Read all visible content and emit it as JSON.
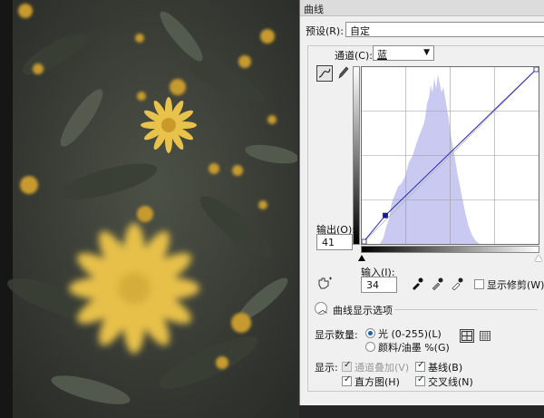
{
  "dialog": {
    "title": "曲线",
    "preset_label": "预设(R):",
    "preset_value": "自定",
    "channel_label": "通道(C):",
    "channel_value": "蓝",
    "output_label": "输出(O):",
    "output_value": "41",
    "input_label": "输入(I):",
    "input_value": "34",
    "show_clipping_label": "显示修剪(W)",
    "display_options_label": "曲线显示选项",
    "show_amount_label": "显示数量:",
    "light_label": "光 (0-255)(L)",
    "pigment_label": "颜料/油墨 %(G)",
    "show_label": "显示:",
    "channel_overlay_label": "通道叠加(V)",
    "baseline_label": "基线(B)",
    "histogram_label": "直方图(H)",
    "intersection_label": "交叉线(N)"
  },
  "state": {
    "light_selected": true,
    "channel_overlay_checked": true,
    "channel_overlay_disabled": true,
    "baseline_checked": true,
    "histogram_checked": true,
    "intersection_checked": true,
    "show_clipping_checked": false
  },
  "curve": {
    "points": [
      [
        0,
        0
      ],
      [
        34,
        41
      ],
      [
        255,
        255
      ]
    ],
    "selected_point": [
      34,
      41
    ],
    "line_color": "#2a2ab8",
    "histogram_color": "#c9c9f2"
  },
  "icons": {
    "curve_tool": "curve-icon",
    "pencil_tool": "pencil-icon",
    "hand_tool": "hand-icon",
    "eyedroppers": [
      "black-eyedropper-icon",
      "gray-eyedropper-icon",
      "white-eyedropper-icon"
    ],
    "expand": "chevron-icon",
    "grid_simple": "grid-4-icon",
    "grid_detail": "grid-10-icon"
  }
}
